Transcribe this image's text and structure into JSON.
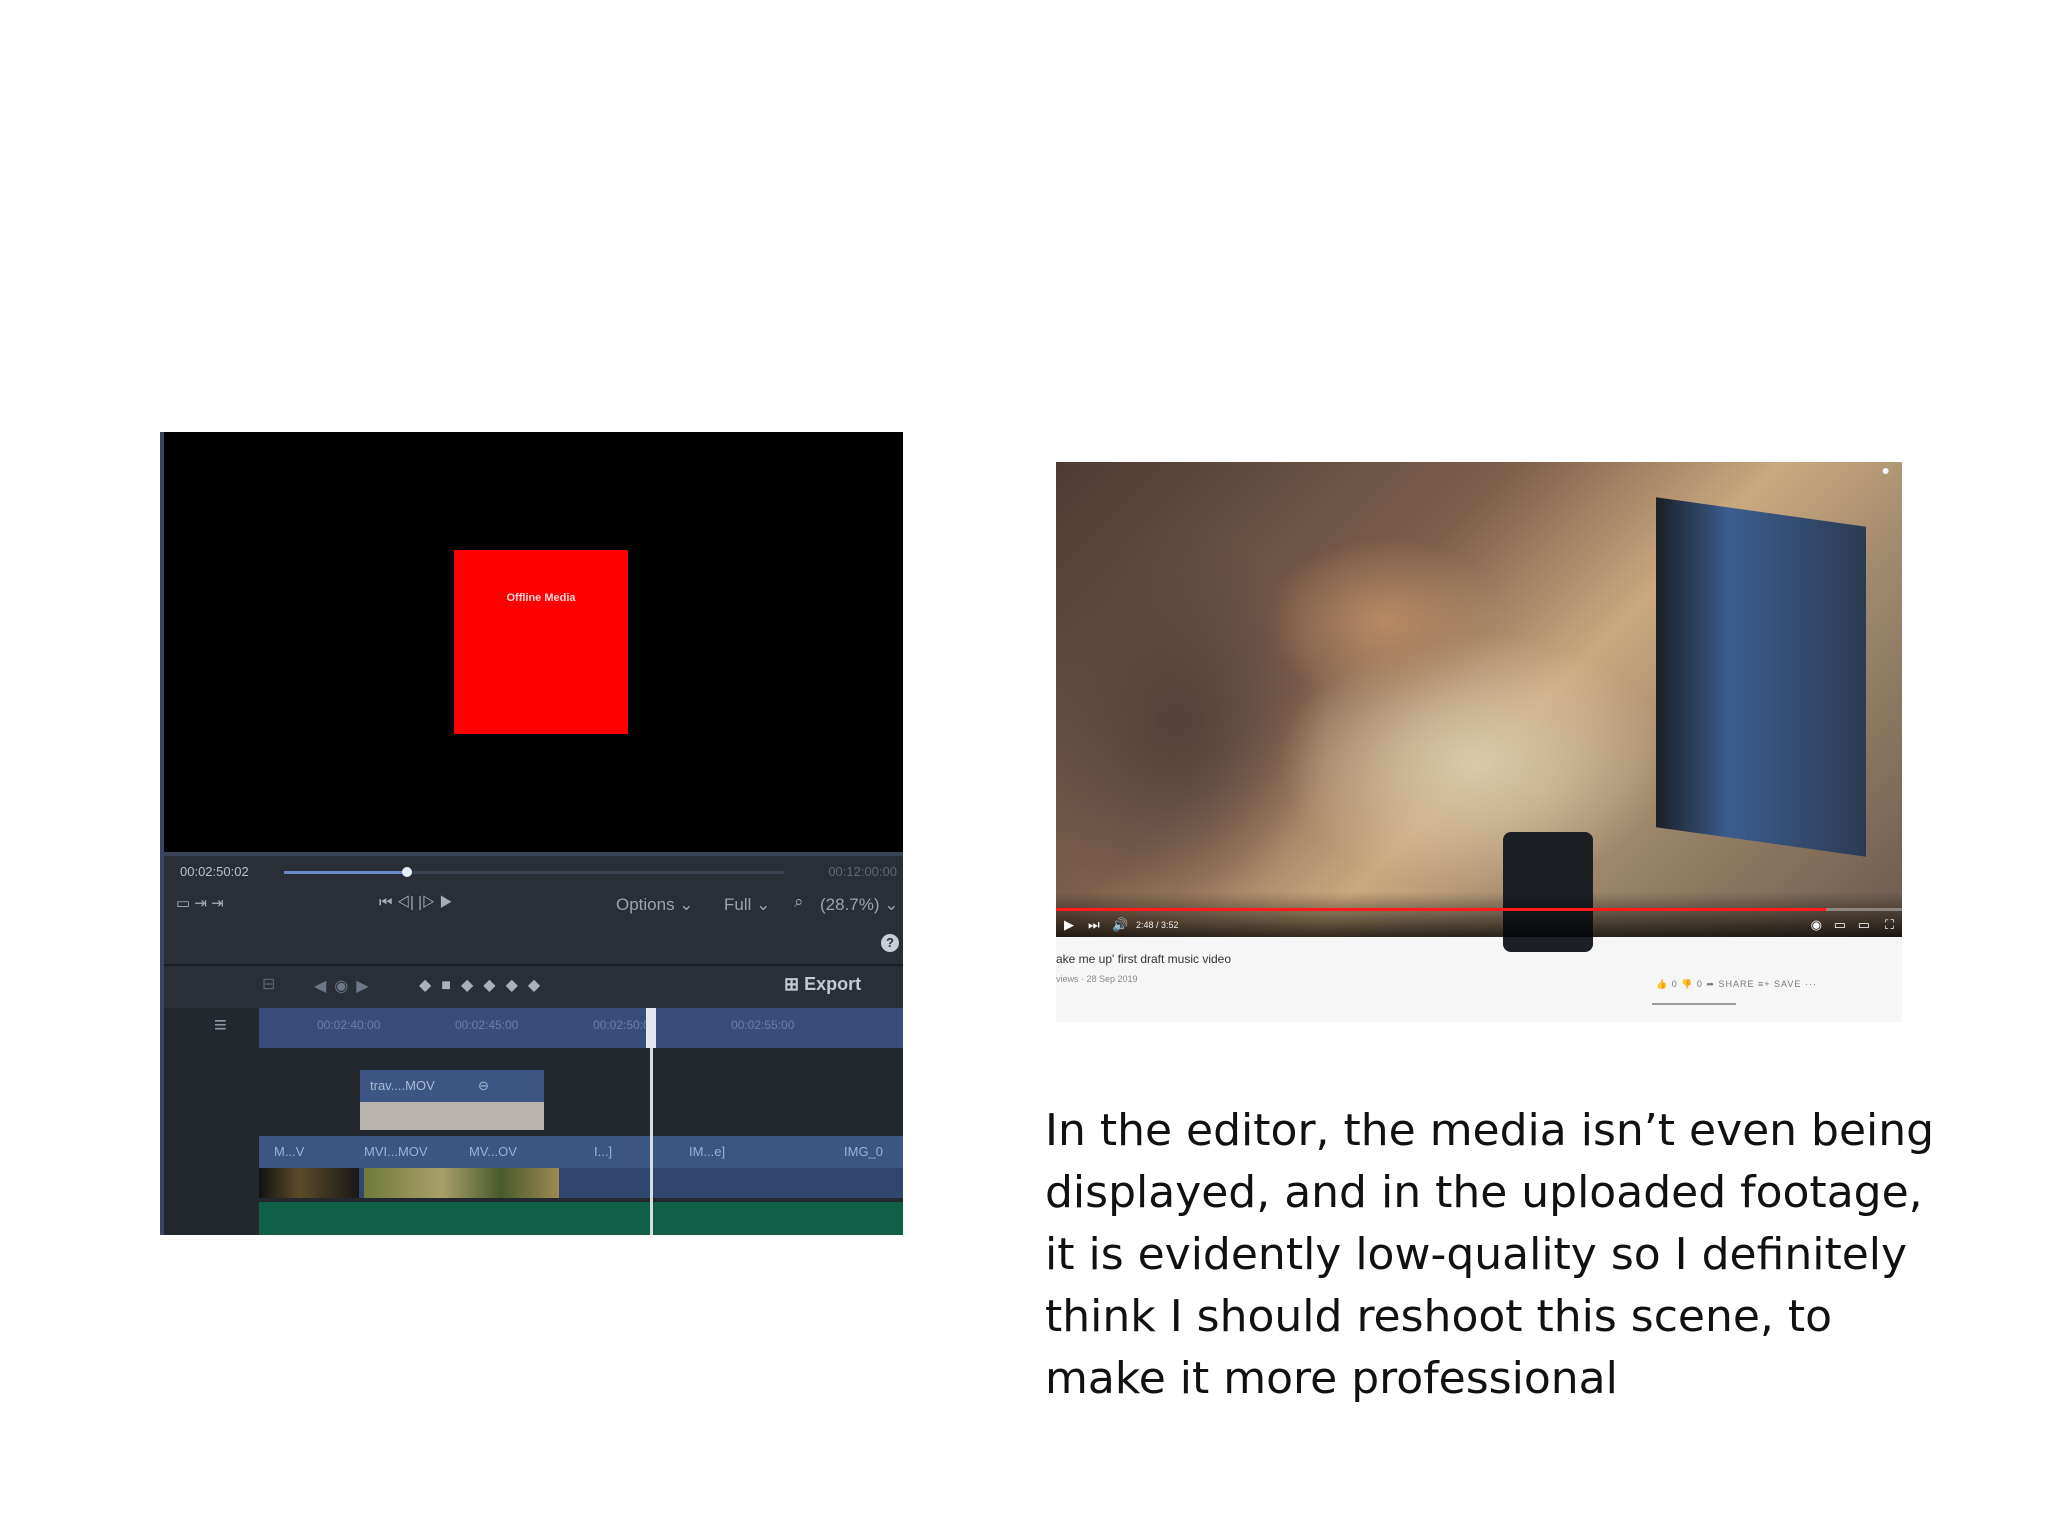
{
  "editor": {
    "offline_label": "Offline Media",
    "timecode_current": "00:02:50:02",
    "timecode_end": "00:12:00:00",
    "transport_icons": "⏮ ◁| |▷ ▶",
    "left_icons": "▭ ⇥ ⇥",
    "options_label": "Options ⌄",
    "full_label": "Full ⌄",
    "zoom_label": "(28.7%) ⌄",
    "help_icon": "?",
    "export_label": "Export",
    "ruler_labels": [
      "00:02:40:00",
      "00:02:45:00",
      "00:02:50:00",
      "00:02:55:00"
    ],
    "clip_top_label": "trav....MOV",
    "video_clips": [
      "M...V",
      "MVI...MOV",
      "MV...OV",
      "I...]",
      "IM...e]",
      "IMG_0"
    ]
  },
  "video": {
    "time": "2:48 / 3:52",
    "title": "ake me up' first draft music video",
    "meta": "views · 28 Sep 2019",
    "actions": "👍 0   👎 0   ➦ SHARE   ≡+ SAVE   ···"
  },
  "caption": {
    "lines": [
      "In the editor, the media isn’t even being",
      "displayed, and in the uploaded footage,",
      "it is evidently low-quality  so I definitely",
      "think I should reshoot this scene, to",
      "make it more professional"
    ]
  }
}
